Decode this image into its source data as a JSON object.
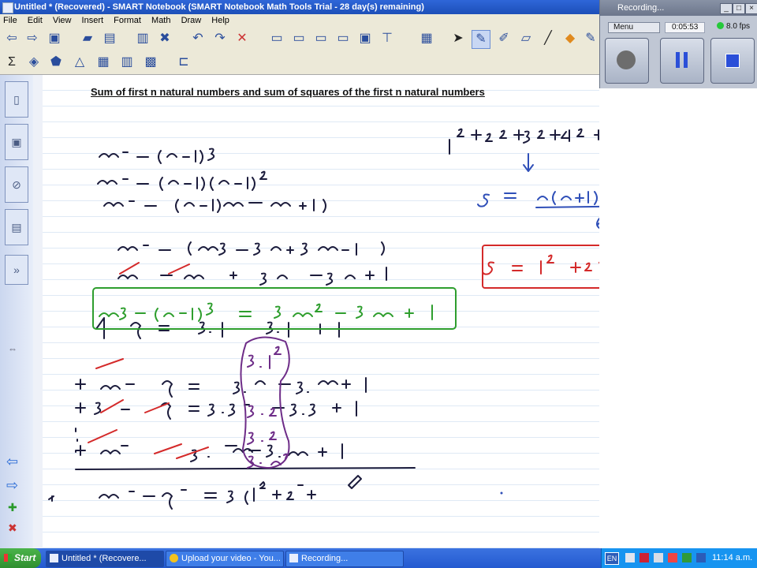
{
  "window": {
    "title": "Untitled * (Recovered) - SMART Notebook (SMART Notebook Math Tools Trial - 28 day(s) remaining)"
  },
  "menu": [
    "File",
    "Edit",
    "View",
    "Insert",
    "Format",
    "Math",
    "Draw",
    "Help"
  ],
  "recorder": {
    "title": "Recording...",
    "menu_label": "Menu",
    "elapsed": "0:05:53",
    "fps": "8.0 fps"
  },
  "page": {
    "title": "Sum of first n natural numbers and sum of squares of the first n natural numbers"
  },
  "taskbar": {
    "start_label": "Start",
    "tasks": [
      "Untitled * (Recovere...",
      "Upload your video - You...",
      "Recording..."
    ],
    "language": "EN",
    "clock": "11:14 a.m."
  },
  "colors": {
    "ink_black": "#1c1c3c",
    "ink_blue": "#2f4fb8",
    "ink_green": "#2e9e2e",
    "ink_red": "#d42a2a",
    "ink_purple": "#6e2d88"
  }
}
